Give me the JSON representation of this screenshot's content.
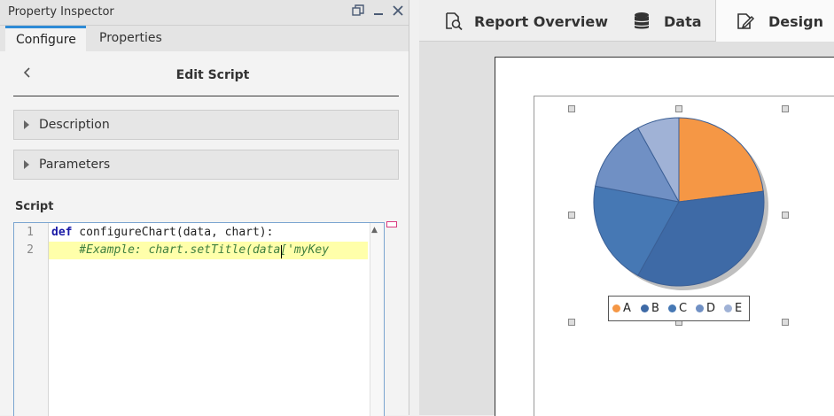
{
  "inspector": {
    "title": "Property Inspector",
    "tabs": [
      {
        "label": "Configure",
        "active": true
      },
      {
        "label": "Properties",
        "active": false
      }
    ],
    "edit_title": "Edit Script",
    "sections": [
      {
        "label": "Description"
      },
      {
        "label": "Parameters"
      }
    ],
    "script_label": "Script",
    "code_lines": [
      {
        "number": "1",
        "keyword": "def",
        "text": " configureChart(data, chart):"
      },
      {
        "number": "2",
        "text": "    #Example: chart.setTitle(data['myKey"
      }
    ]
  },
  "main_tabs": [
    {
      "label": "Report Overview",
      "icon": "report-search-icon"
    },
    {
      "label": "Data",
      "icon": "database-icon"
    },
    {
      "label": "Design",
      "icon": "edit-document-icon",
      "active": true
    }
  ],
  "legend": [
    {
      "label": "A",
      "color": "#f59745"
    },
    {
      "label": "B",
      "color": "#3e6aa6"
    },
    {
      "label": "C",
      "color": "#4678b4"
    },
    {
      "label": "D",
      "color": "#7090c4"
    },
    {
      "label": "E",
      "color": "#a0b2d6"
    }
  ],
  "colors": {
    "accent": "#2e8bd6",
    "pie_a": "#f59745",
    "pie_b": "#3e6aa6",
    "pie_c": "#4678b4",
    "pie_d": "#7090c4",
    "pie_e": "#a0b2d6"
  },
  "chart_data": {
    "type": "pie",
    "categories": [
      "A",
      "B",
      "C",
      "D",
      "E"
    ],
    "values": [
      23,
      35,
      20,
      14,
      8
    ],
    "legend_position": "bottom"
  }
}
